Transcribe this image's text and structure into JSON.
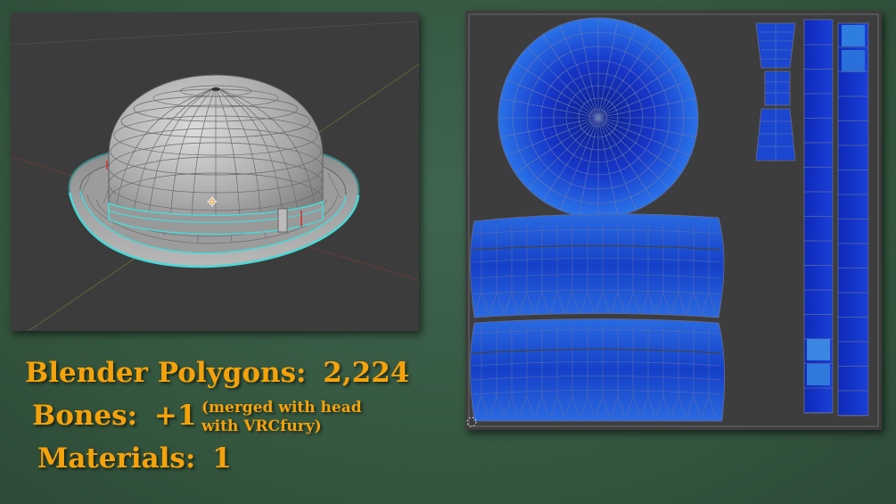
{
  "stats": {
    "polygons_label": "Blender Polygons:",
    "polygons_value": "2,224",
    "bones_label": "Bones:",
    "bones_value": "+1",
    "bones_note_line1": "(merged with head",
    "bones_note_line2": "with VRCfury)",
    "materials_label": "Materials:",
    "materials_value": "1"
  },
  "colors": {
    "background": "#35573f",
    "text": "#f5a20a",
    "viewport_bg": "#3c3c3c",
    "mesh": "#a8a8a8",
    "seam": "#4ad8d8",
    "uv_fill": "#1c4fd0"
  },
  "icons": {
    "origin": "origin-marker-icon",
    "cursor": "uv-2d-cursor-icon"
  }
}
